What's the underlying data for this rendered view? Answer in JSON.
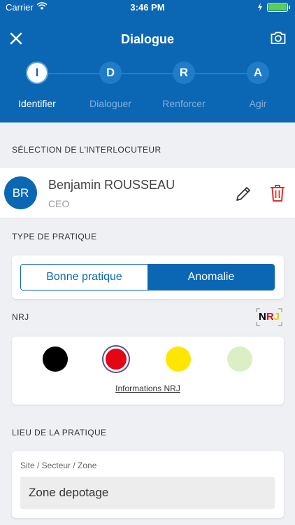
{
  "status_bar": {
    "carrier": "Carrier",
    "time": "3:46 PM"
  },
  "nav": {
    "title": "Dialogue",
    "close_icon": "close-icon",
    "camera_icon": "camera-icon"
  },
  "steps": [
    {
      "letter": "I",
      "label": "Identifier",
      "active": true
    },
    {
      "letter": "D",
      "label": "Dialoguer",
      "active": false
    },
    {
      "letter": "R",
      "label": "Renforcer",
      "active": false
    },
    {
      "letter": "A",
      "label": "Agir",
      "active": false
    }
  ],
  "interlocuteur": {
    "section_title": "SÉLECTION DE L'INTERLOCUTEUR",
    "initials": "BR",
    "name": "Benjamin ROUSSEAU",
    "role": "CEO"
  },
  "pratique": {
    "section_title": "TYPE DE PRATIQUE",
    "options": [
      "Bonne pratique",
      "Anomalie"
    ],
    "selected": "Anomalie"
  },
  "nrj": {
    "section_title": "NRJ",
    "logo_text": "NRJ",
    "colors": [
      "#000000",
      "#e30613",
      "#ffe600",
      "#dcefc4"
    ],
    "selected_color": "#e30613",
    "link_label": "Informations NRJ"
  },
  "lieu": {
    "section_title": "LIEU DE LA PRATIQUE",
    "field_label": "Site / Secteur / Zone",
    "field_value": "Zone depotage"
  },
  "theme": {
    "primary": "#0b67b4",
    "danger": "#e0312c"
  }
}
